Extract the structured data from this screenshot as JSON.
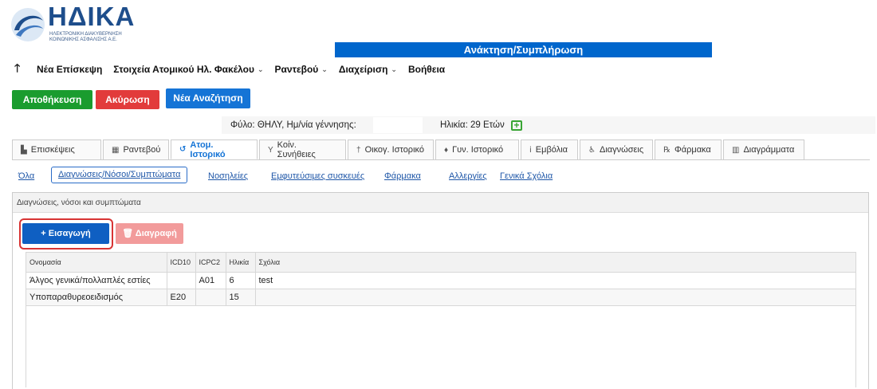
{
  "logo": {
    "word": "ΗΔΙΚΑ",
    "subtitle": "ΗΛΕΚΤΡΟΝΙΚΗ ΔΙΑΚΥΒΕΡΝΗΣΗ\nΚΟΙΝΩΝΙΚΗΣ ΑΣΦΑΛΙΣΗΣ Α.Ε."
  },
  "header": {
    "title": "Ανάκτηση/Συμπλήρωση"
  },
  "menu": [
    {
      "label": "Νέα Επίσκεψη",
      "dropdown": false
    },
    {
      "label": "Στοιχεία Ατομικού Ηλ. Φακέλου",
      "dropdown": true
    },
    {
      "label": "Ραντεβού",
      "dropdown": true
    },
    {
      "label": "Διαχείριση",
      "dropdown": true
    },
    {
      "label": "Βοήθεια",
      "dropdown": false
    }
  ],
  "actions": {
    "save": "Αποθήκευση",
    "cancel": "Ακύρωση",
    "new_search": "Νέα Αναζήτηση"
  },
  "patient": {
    "gender_dob": "Φύλο: ΘΗΛΥ,  Ημ/νία γέννησης:",
    "age": "Ηλικία: 29 Ετών"
  },
  "tabs": [
    {
      "label": "Επισκέψεις",
      "icon": "visits-icon",
      "glyph": "▙"
    },
    {
      "label": "Ραντεβού",
      "icon": "calendar-icon",
      "glyph": "▦"
    },
    {
      "label": "Ατομ. Ιστορικό",
      "icon": "history-icon",
      "glyph": "↺"
    },
    {
      "label": "Κοίν. Συνήθειες",
      "icon": "glass-icon",
      "glyph": "Y"
    },
    {
      "label": "Οικογ. Ιστορικό",
      "icon": "person-icon",
      "glyph": "†"
    },
    {
      "label": "Γυν. Ιστορικό",
      "icon": "female-icon",
      "glyph": "♦"
    },
    {
      "label": "Εμβόλια",
      "icon": "syringe-icon",
      "glyph": "ⅰ"
    },
    {
      "label": "Διαγνώσεις",
      "icon": "accessibility-icon",
      "glyph": "♿"
    },
    {
      "label": "Φάρμακα",
      "icon": "rx-icon",
      "glyph": "℞"
    },
    {
      "label": "Διαγράμματα",
      "icon": "chart-icon",
      "glyph": "▥"
    }
  ],
  "subnav": [
    "Όλα",
    "Διαγνώσεις/Νόσοι/Συμπτώματα",
    "Νοσηλείες",
    "Εμφυτεύσιμες συσκευές",
    "Φάρμακα",
    "Αλλεργίες",
    "Γενικά Σχόλια"
  ],
  "panel": {
    "title": "Διαγνώσεις, νόσοι και συμπτώματα",
    "insert": "+ Εισαγωγή",
    "delete": "🗑 Διαγραφή"
  },
  "table": {
    "headers": [
      "Ονομασία",
      "ICD10",
      "ICPC2",
      "Ηλικία",
      "Σχόλια"
    ],
    "rows": [
      [
        "Άλγος γενικά/πολλαπλές εστίες",
        "",
        "A01",
        "6",
        "test"
      ],
      [
        "Υποπαραθυρεοειδισμός",
        "E20",
        "",
        "15",
        ""
      ]
    ]
  },
  "colors": {
    "brand": "#1e4e8c",
    "header_bar": "#0066cc",
    "save": "#1a9c2e",
    "cancel": "#e23b3b",
    "primary": "#1574d6",
    "highlight": "#d83434"
  }
}
